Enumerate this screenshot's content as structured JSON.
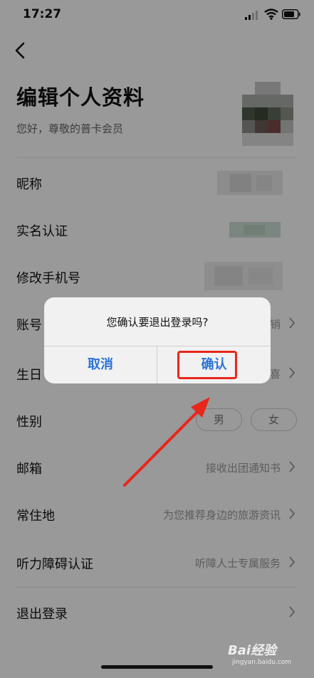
{
  "status_bar": {
    "time": "17:27"
  },
  "header": {
    "title": "编辑个人资料",
    "subtitle": "您好，尊敬的普卡会员"
  },
  "rows": [
    {
      "label": "昵称"
    },
    {
      "label": "实名认证"
    },
    {
      "label": "修改手机号"
    },
    {
      "label": "账号",
      "hint": "销"
    },
    {
      "label": "生日",
      "hint": "喜"
    },
    {
      "label": "性别",
      "options": [
        "男",
        "女"
      ]
    },
    {
      "label": "邮箱",
      "hint": "接收出团通知书"
    },
    {
      "label": "常住地",
      "hint": "为您推荐身边的旅游资讯"
    },
    {
      "label": "听力障碍认证",
      "hint": "听障人士专属服务"
    },
    {
      "label": "退出登录"
    }
  ],
  "dialog": {
    "message": "您确认要退出登录吗?",
    "cancel_label": "取消",
    "confirm_label": "确认"
  },
  "watermark": {
    "brand": "Bai经验",
    "url": "jingyan.baidu.com"
  },
  "colors": {
    "accent": "#2b73d6",
    "highlight": "#e8261c"
  }
}
